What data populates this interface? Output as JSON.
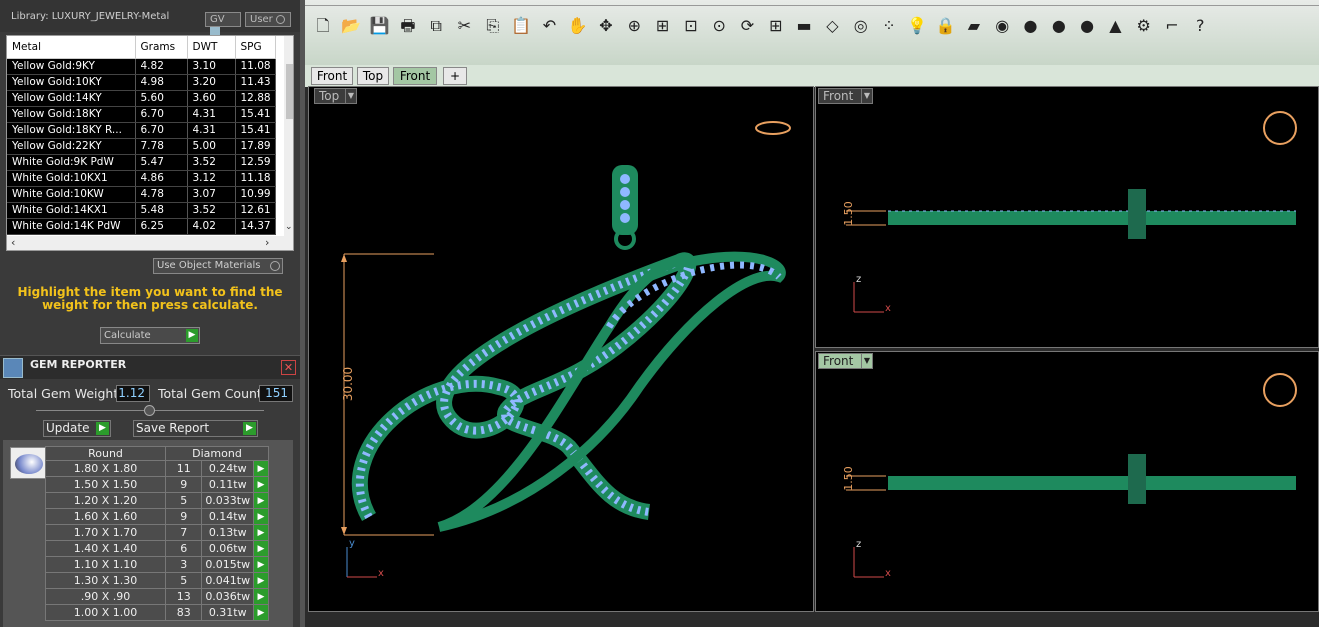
{
  "library": {
    "title": "Library: LUXURY_JEWELRY-Metal",
    "gv_label": "GV",
    "user_label": "User",
    "columns": [
      "Metal",
      "Grams",
      "DWT",
      "SPG"
    ],
    "rows": [
      [
        "Yellow Gold:9KY",
        "4.82",
        "3.10",
        "11.08"
      ],
      [
        "Yellow Gold:10KY",
        "4.98",
        "3.20",
        "11.43"
      ],
      [
        "Yellow Gold:14KY",
        "5.60",
        "3.60",
        "12.88"
      ],
      [
        "Yellow Gold:18KY",
        "6.70",
        "4.31",
        "15.41"
      ],
      [
        "Yellow Gold:18KY R...",
        "6.70",
        "4.31",
        "15.41"
      ],
      [
        "Yellow Gold:22KY",
        "7.78",
        "5.00",
        "17.89"
      ],
      [
        "White Gold:9K PdW",
        "5.47",
        "3.52",
        "12.59"
      ],
      [
        "White Gold:10KX1",
        "4.86",
        "3.12",
        "11.18"
      ],
      [
        "White Gold:10KW",
        "4.78",
        "3.07",
        "10.99"
      ],
      [
        "White Gold:14KX1",
        "5.48",
        "3.52",
        "12.61"
      ],
      [
        "White Gold:14K PdW",
        "6.25",
        "4.02",
        "14.37"
      ]
    ],
    "use_object_materials": "Use Object Materials",
    "hint": "Highlight the item you want to find the weight for then press calculate.",
    "calculate_label": "Calculate"
  },
  "gem_reporter": {
    "title": "GEM REPORTER",
    "total_weight_label": "Total Gem Weight",
    "total_weight_value": "1.12",
    "total_count_label": "Total Gem Count",
    "total_count_value": "151",
    "update_label": "Update",
    "save_report_label": "Save Report",
    "shape": "Round",
    "material": "Diamond",
    "rows": [
      [
        "1.80 X 1.80",
        "11",
        "0.24tw"
      ],
      [
        "1.50 X 1.50",
        "9",
        "0.11tw"
      ],
      [
        "1.20 X 1.20",
        "5",
        "0.033tw"
      ],
      [
        "1.60 X 1.60",
        "9",
        "0.14tw"
      ],
      [
        "1.70 X 1.70",
        "7",
        "0.13tw"
      ],
      [
        "1.40 X 1.40",
        "6",
        "0.06tw"
      ],
      [
        "1.10 X 1.10",
        "3",
        "0.015tw"
      ],
      [
        "1.30 X 1.30",
        "5",
        "0.041tw"
      ],
      [
        ".90 X .90",
        "13",
        "0.036tw"
      ],
      [
        "1.00 X 1.00",
        "83",
        "0.31tw"
      ]
    ]
  },
  "toolbar": {
    "icons": [
      "new-icon",
      "open-icon",
      "save-icon",
      "print-icon",
      "export-icon",
      "cut-icon",
      "copy-icon",
      "paste-icon",
      "undo-icon",
      "pan-icon",
      "move-icon",
      "zoom-in-icon",
      "zoom-window-icon",
      "zoom-extents-icon",
      "zoom-selected-icon",
      "rotate-view-icon",
      "four-viewports-icon",
      "car-icon",
      "hide-icon",
      "snap-icon",
      "points-icon",
      "light-icon",
      "lock-icon",
      "layers-icon",
      "color-wheel-icon",
      "shade-icon",
      "render-icon",
      "material-icon",
      "selection-icon",
      "settings-icon",
      "gumball-icon",
      "help-icon"
    ]
  },
  "tabs": {
    "items": [
      "Front",
      "Top",
      "Front"
    ],
    "add": "+"
  },
  "viewports": {
    "top": {
      "label": "Top",
      "dimension": "30.00"
    },
    "front1": {
      "label": "Front",
      "dimension": "1.50"
    },
    "front2": {
      "label": "Front",
      "dimension": "1.50"
    }
  },
  "axes": {
    "x": "x",
    "y": "y",
    "z": "z"
  },
  "colors": {
    "accent_green": "#2c9c2c",
    "hint_yellow": "#f2c21b",
    "gem_blue": "#8fb8ff",
    "metal_green": "#1e8a5e"
  }
}
